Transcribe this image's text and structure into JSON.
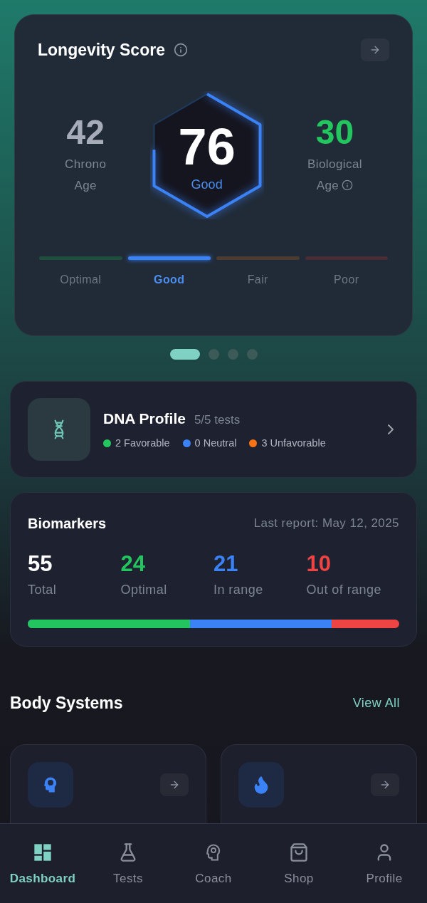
{
  "score_card": {
    "title": "Longevity Score",
    "chrono": {
      "value": "42",
      "label_1": "Chrono",
      "label_2": "Age"
    },
    "score": {
      "value": "76",
      "label": "Good"
    },
    "biological": {
      "value": "30",
      "label_1": "Biological",
      "label_2": "Age"
    },
    "scale": [
      {
        "label": "Optimal",
        "color": "#1f4e3c",
        "selected": false
      },
      {
        "label": "Good",
        "color": "#3b82f6",
        "selected": true
      },
      {
        "label": "Fair",
        "color": "#4d3a30",
        "selected": false
      },
      {
        "label": "Poor",
        "color": "#4a2c35",
        "selected": false
      }
    ]
  },
  "pager": [
    {
      "selected": true
    },
    {
      "selected": false
    },
    {
      "selected": false
    },
    {
      "selected": false
    }
  ],
  "dna_profile": {
    "title": "DNA Profile",
    "tests": "5/5 tests",
    "legend": [
      {
        "label": "2 Favorable",
        "color": "#22c55e"
      },
      {
        "label": "0 Neutral",
        "color": "#3b82f6"
      },
      {
        "label": "3 Unfavorable",
        "color": "#f97316"
      }
    ]
  },
  "biomarkers": {
    "title": "Biomarkers",
    "last_report": "Last report: May 12, 2025",
    "stats": [
      {
        "value": "55",
        "label": "Total",
        "color": "#ffffff"
      },
      {
        "value": "24",
        "label": "Optimal",
        "color": "#22c55e"
      },
      {
        "value": "21",
        "label": "In range",
        "color": "#3b82f6"
      },
      {
        "value": "10",
        "label": "Out of range",
        "color": "#ef4444"
      }
    ],
    "bar": {
      "color": "#ef4444",
      "fills": [
        {
          "level": 0.818,
          "color": "#3b82f6"
        },
        {
          "level": 0.436,
          "color": "#22c55e"
        }
      ]
    }
  },
  "body_systems": {
    "title": "Body Systems",
    "view_all": "View All",
    "cards": [
      {
        "kind": "brain"
      },
      {
        "kind": "flame"
      }
    ]
  },
  "nav": [
    {
      "label": "Dashboard",
      "kind": "dashboard",
      "selected": true
    },
    {
      "label": "Tests",
      "kind": "tests",
      "selected": false
    },
    {
      "label": "Coach",
      "kind": "coach",
      "selected": false
    },
    {
      "label": "Shop",
      "kind": "shop",
      "selected": false
    },
    {
      "label": "Profile",
      "kind": "profile",
      "selected": false
    }
  ]
}
